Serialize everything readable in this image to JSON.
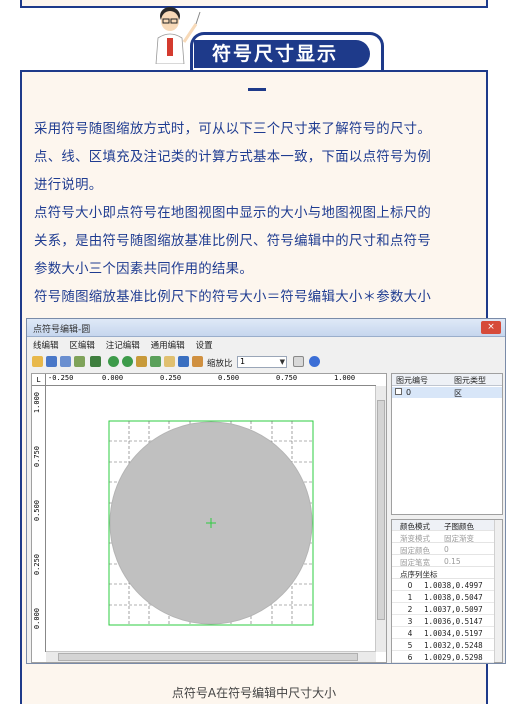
{
  "header": {
    "title": "符号尺寸显示"
  },
  "paragraphs": [
    "采用符号随图缩放方式时，可从以下三个尺寸来了解符号的尺寸。",
    "点、线、区填充及注记类的计算方式基本一致，下面以点符号为例",
    "进行说明。",
    "点符号大小即点符号在地图视图中显示的大小与地图视图上标尺的",
    "关系，是由符号随图缩放基准比例尺、符号编辑中的尺寸和点符号",
    "参数大小三个因素共同作用的结果。",
    "符号随图缩放基准比例尺下的符号大小＝符号编辑大小＊参数大小"
  ],
  "window": {
    "title": "点符号编辑-圆",
    "close": "×",
    "menu": [
      "线编辑",
      "区编辑",
      "注记编辑",
      "通用编辑",
      "设置"
    ],
    "zoom_label": "缩放比",
    "zoom_value": "1"
  },
  "ruler": {
    "h_ticks": [
      "-0.250",
      "0.000",
      "0.250",
      "0.500",
      "0.750",
      "1.000"
    ],
    "v_ticks": [
      "1.000",
      "0.750",
      "0.500",
      "0.250",
      "0.000"
    ],
    "corner": "L"
  },
  "element_panel": {
    "col1": "图元编号",
    "col2": "图元类型",
    "row": {
      "id": "0",
      "type": "区"
    }
  },
  "properties": {
    "header": {
      "key": "颜色模式",
      "value": "子图颜色"
    },
    "rows": [
      {
        "key": "渐变模式",
        "value": "固定渐变"
      },
      {
        "key": "固定颜色",
        "value": "0"
      },
      {
        "key": "固定笔宽",
        "value": "0.15"
      }
    ],
    "coord_title": "点序列坐标",
    "coords": [
      {
        "i": "0",
        "v": "1.0038,0.4997"
      },
      {
        "i": "1",
        "v": "1.0038,0.5047"
      },
      {
        "i": "2",
        "v": "1.0037,0.5097"
      },
      {
        "i": "3",
        "v": "1.0036,0.5147"
      },
      {
        "i": "4",
        "v": "1.0034,0.5197"
      },
      {
        "i": "5",
        "v": "1.0032,0.5248"
      },
      {
        "i": "6",
        "v": "1.0029,0.5298"
      }
    ]
  },
  "caption": "点符号A在符号编辑中尺寸大小",
  "colors": {
    "accent": "#1e3a8a",
    "text": "#1f3c91",
    "circle": "#c0c0c0",
    "grid": "#2ecc40"
  }
}
